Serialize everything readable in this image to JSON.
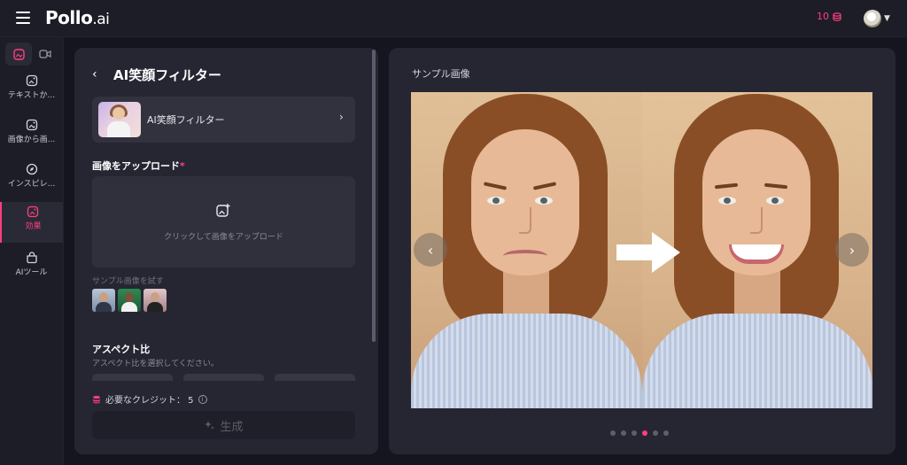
{
  "app": {
    "logo_main": "Pollo",
    "logo_suffix": ".ai",
    "credits": "10"
  },
  "colors": {
    "accent": "#ff3f7d",
    "background": "#151520",
    "panel": "#262633"
  },
  "sidebar": {
    "tabs": [
      {
        "icon": "image-icon",
        "active": true
      },
      {
        "icon": "video-icon",
        "active": false
      }
    ],
    "items": [
      {
        "label": "テキストか...",
        "icon": "text-to-image-icon",
        "active": false
      },
      {
        "label": "画像から画...",
        "icon": "image-to-image-icon",
        "active": false
      },
      {
        "label": "インスピレ...",
        "icon": "compass-icon",
        "active": false
      },
      {
        "label": "効果",
        "icon": "effects-icon",
        "active": true
      },
      {
        "label": "AIツール",
        "icon": "ai-tools-icon",
        "active": false
      }
    ]
  },
  "panel": {
    "title": "AI笑顔フィルター",
    "effect": {
      "name": "AI笑顔フィルター"
    },
    "upload": {
      "label": "画像をアップロード",
      "required_mark": "*",
      "hint": "クリックして画像をアップロード"
    },
    "samples": {
      "label": "サンプル画像を試す"
    },
    "aspect": {
      "title": "アスペクト比",
      "subtitle": "アスペクト比を選択してください。"
    },
    "credit_need": "必要なクレジット： 5",
    "generate": "生成"
  },
  "preview": {
    "title": "サンプル画像",
    "dots_total": 6,
    "dots_active_index": 3
  }
}
